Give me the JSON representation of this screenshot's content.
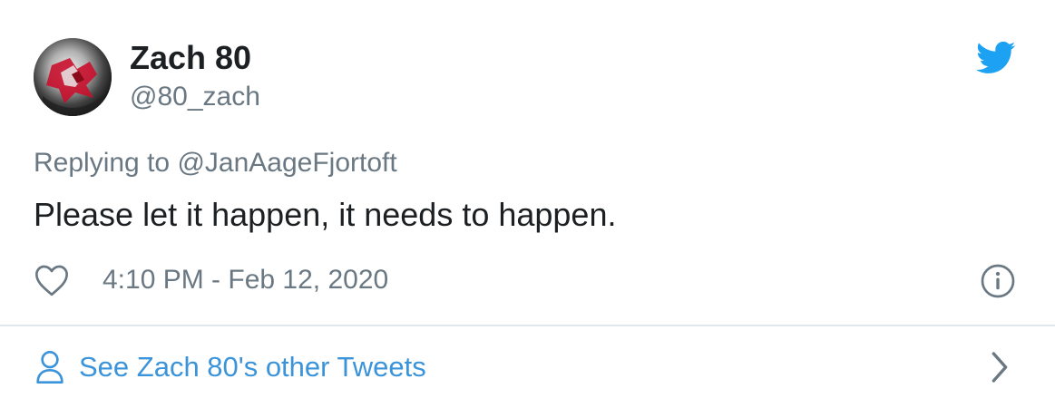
{
  "tweet": {
    "author_name": "Zach 80",
    "author_handle": "@80_zach",
    "replying_prefix": "Replying to",
    "replying_to": "@JanAageFjortoft",
    "text": "Please let it happen, it needs to happen.",
    "timestamp": "4:10 PM - Feb 12, 2020"
  },
  "footer": {
    "link_label": "See Zach 80's other Tweets"
  },
  "icons": {
    "brand": "twitter-bird-icon",
    "like": "heart-icon",
    "info": "info-icon",
    "profile": "person-icon",
    "more": "chevron-right-icon"
  },
  "colors": {
    "twitter_blue": "#1da1f2",
    "link_blue": "#3b94d9",
    "secondary_text": "#697882",
    "primary_text": "#1c2022",
    "divider": "#e1e8ed"
  }
}
